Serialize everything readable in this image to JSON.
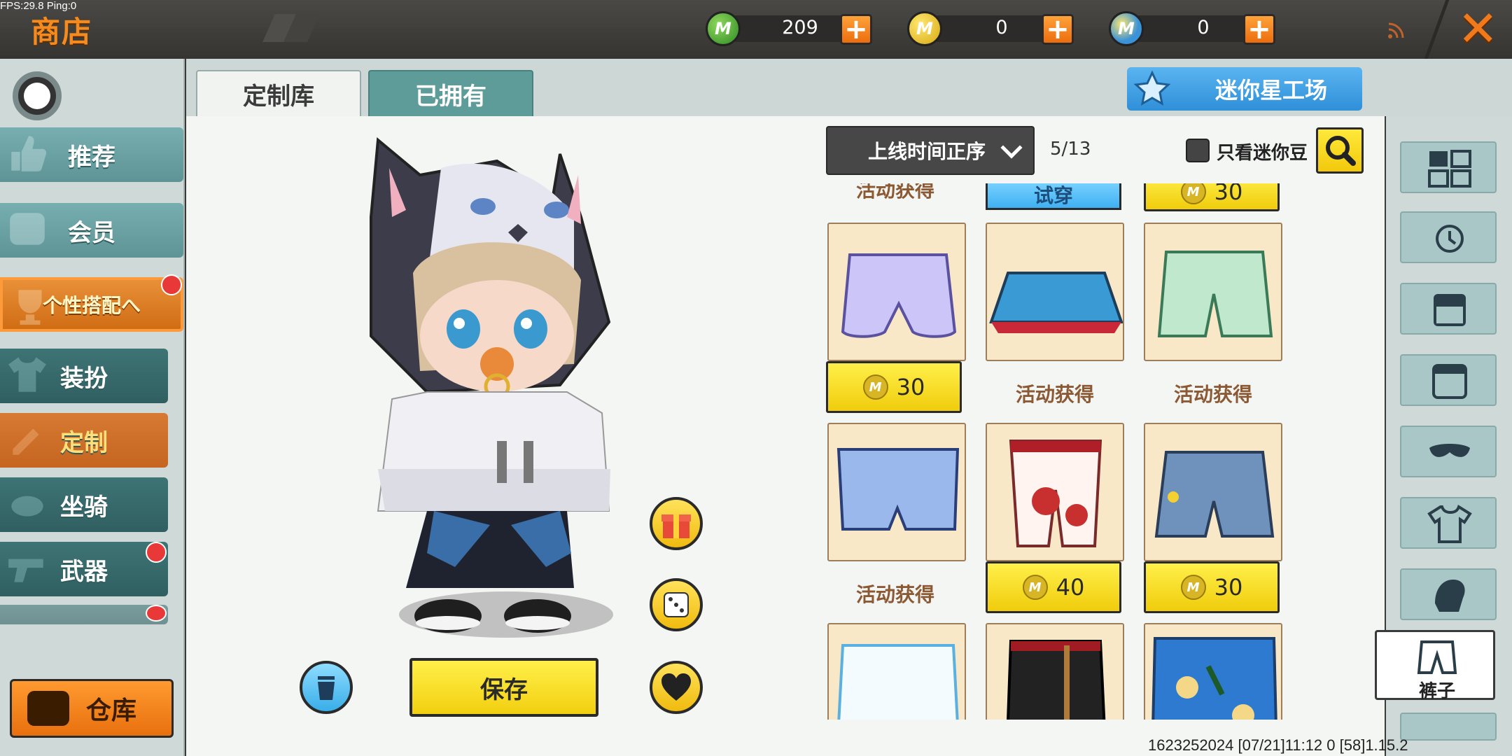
{
  "status_bar": {
    "fps": "FPS:29.8  Ping:0"
  },
  "header": {
    "title": "商店",
    "currencies": [
      {
        "icon": "green-gem-icon",
        "value": "209",
        "color": "#3b9a2e"
      },
      {
        "icon": "gold-coin-icon",
        "value": "0",
        "color": "#e8c21c"
      },
      {
        "icon": "blue-coin-icon",
        "value": "0",
        "color": "#3a92d8"
      }
    ],
    "plus_label": "+",
    "close_label": "✕"
  },
  "sidebar": {
    "items": [
      {
        "label": "推荐"
      },
      {
        "label": "会员"
      },
      {
        "label": "个性搭配へ"
      },
      {
        "label": "装扮"
      },
      {
        "label": "定制"
      },
      {
        "label": "坐骑"
      },
      {
        "label": "武器"
      }
    ],
    "warehouse_label": "仓库"
  },
  "tabs": [
    {
      "label": "定制库",
      "active": true
    },
    {
      "label": "已拥有",
      "active": false
    }
  ],
  "workshop_label": "迷你星工场",
  "toolbar": {
    "sort_label": "上线时间正序",
    "page": "5/13",
    "filter_label": "只看迷你豆"
  },
  "preview": {
    "save_label": "保存"
  },
  "grid": {
    "top_row": {
      "left": "活动获得",
      "middle": "试穿",
      "right": "30"
    },
    "items": [
      {
        "name": "lavender-bloomers",
        "price": "30",
        "event": null
      },
      {
        "name": "blue-pleated-skirt",
        "price": null,
        "event": "活动获得"
      },
      {
        "name": "mint-shorts",
        "price": null,
        "event": "活动获得"
      },
      {
        "name": "periwinkle-shorts",
        "price": null,
        "event": "活动获得"
      },
      {
        "name": "cloud-pattern-pants",
        "price": "40",
        "event": null
      },
      {
        "name": "denim-shorts",
        "price": "30",
        "event": null
      },
      {
        "name": "white-shorts",
        "price": null,
        "event": null
      },
      {
        "name": "black-pants",
        "price": null,
        "event": null
      },
      {
        "name": "palm-print-shorts",
        "price": null,
        "event": null
      }
    ]
  },
  "right_panel": {
    "selected_label": "裤子"
  },
  "footer": {
    "status": "1623252024  [07/21]11:12 0    [58]1.15.2"
  }
}
